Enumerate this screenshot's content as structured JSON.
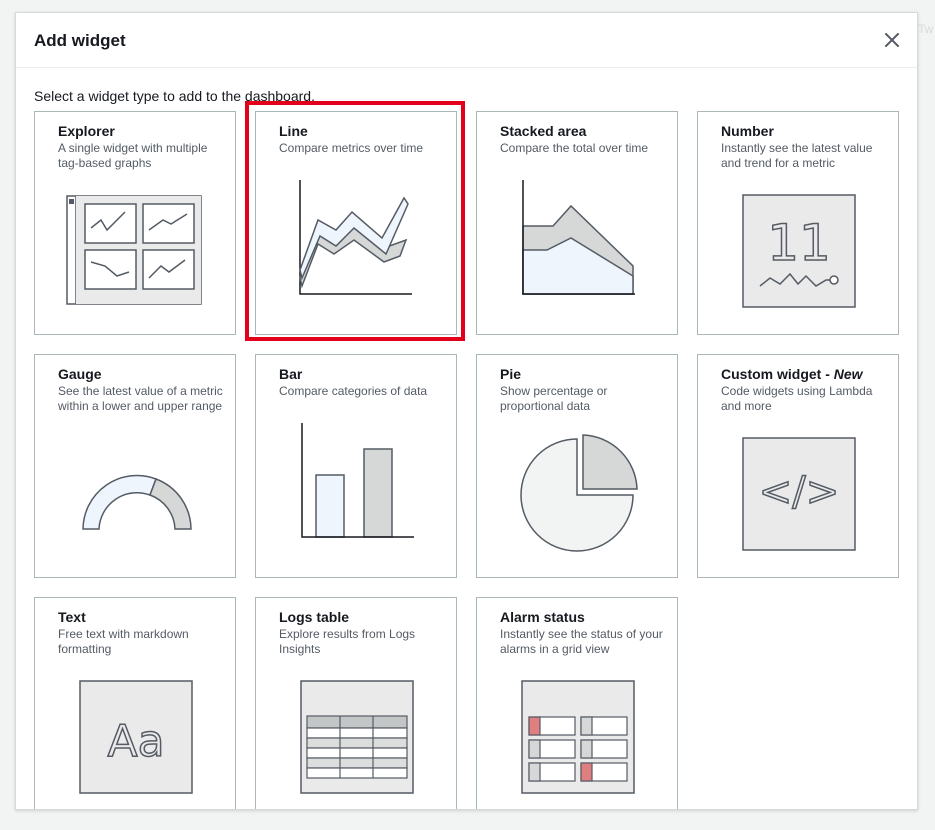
{
  "background_hint": "Tw",
  "modal": {
    "title": "Add widget",
    "subtitle": "Select a widget type to add to the dashboard.",
    "close_icon": "close-icon"
  },
  "widgets": [
    {
      "title": "Explorer",
      "desc": "A single widget with multiple tag-based graphs",
      "icon": "explorer-icon"
    },
    {
      "title": "Line",
      "desc": "Compare metrics over time",
      "icon": "line-chart-icon",
      "selected": true
    },
    {
      "title": "Stacked area",
      "desc": "Compare the total over time",
      "icon": "stacked-area-icon"
    },
    {
      "title": "Number",
      "desc": "Instantly see the latest value and trend for a metric",
      "icon": "number-icon",
      "number_value": "11"
    },
    {
      "title": "Gauge",
      "desc": "See the latest value of a metric within a lower and upper range",
      "icon": "gauge-icon"
    },
    {
      "title": "Bar",
      "desc": "Compare categories of data",
      "icon": "bar-chart-icon"
    },
    {
      "title": "Pie",
      "desc": "Show percentage or proportional data",
      "icon": "pie-chart-icon"
    },
    {
      "title": "Custom widget - ",
      "title_suffix": "New",
      "desc": "Code widgets using Lambda and more",
      "icon": "code-icon",
      "code_glyph": "</>"
    },
    {
      "title": "Text",
      "desc": "Free text with markdown formatting",
      "icon": "text-icon",
      "text_glyph": "Aa"
    },
    {
      "title": "Logs table",
      "desc": "Explore results from Logs Insights",
      "icon": "table-icon"
    },
    {
      "title": "Alarm status",
      "desc": "Instantly see the status of your alarms in a grid view",
      "icon": "alarm-status-icon"
    }
  ],
  "colors": {
    "highlight": "#e3001b",
    "icon_fill_gray": "#d5d8d7",
    "icon_fill_blue": "#eef5fc",
    "alarm_red": "#e07f7f"
  }
}
